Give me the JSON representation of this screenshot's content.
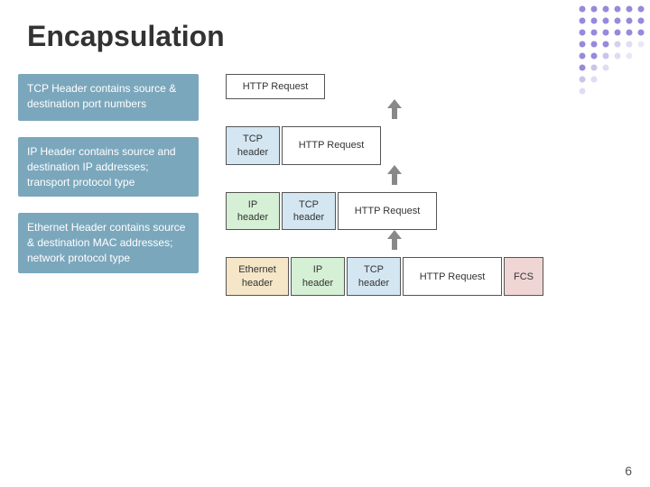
{
  "title": "Encapsulation",
  "descriptions": [
    {
      "id": "tcp-desc",
      "text": "TCP Header contains source & destination port numbers"
    },
    {
      "id": "ip-desc",
      "text": "IP Header contains source and destination IP addresses; transport protocol type"
    },
    {
      "id": "ethernet-desc",
      "text": "Ethernet Header contains source & destination MAC addresses; network protocol type"
    }
  ],
  "diagram": {
    "rows": [
      {
        "id": "row1",
        "cells": [
          {
            "label": "HTTP Request",
            "type": "http"
          }
        ]
      },
      {
        "id": "row2",
        "cells": [
          {
            "label": "TCP\nheader",
            "type": "tcp"
          },
          {
            "label": "HTTP Request",
            "type": "http"
          }
        ]
      },
      {
        "id": "row3",
        "cells": [
          {
            "label": "IP\nheader",
            "type": "ip"
          },
          {
            "label": "TCP\nheader",
            "type": "tcp"
          },
          {
            "label": "HTTP Request",
            "type": "http"
          }
        ]
      },
      {
        "id": "row4",
        "cells": [
          {
            "label": "Ethernet\nheader",
            "type": "ethernet"
          },
          {
            "label": "IP\nheader",
            "type": "ip"
          },
          {
            "label": "TCP\nheader",
            "type": "tcp"
          },
          {
            "label": "HTTP Request",
            "type": "http"
          },
          {
            "label": "FCS",
            "type": "fcs"
          }
        ]
      }
    ]
  },
  "page_number": "6",
  "colors": {
    "desc_bg": "#7ba7bc",
    "http": "#ffffff",
    "tcp": "#d4e6f1",
    "ip": "#d5f0d5",
    "ethernet": "#f5e6c8",
    "fcs": "#f0d5d5"
  }
}
